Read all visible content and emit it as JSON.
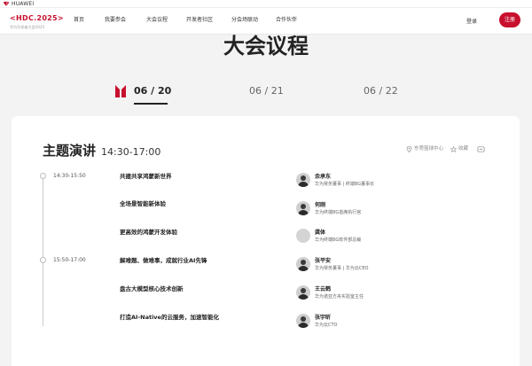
{
  "topbar": {
    "brand_text": "HUAWEI"
  },
  "header": {
    "logo_code": "<HDC.2025>",
    "logo_sub": "华为开发者大会2025",
    "nav": [
      "首页",
      "我要参会",
      "大会议程",
      "开发者社区",
      "分会场联动",
      "合作伙伴"
    ],
    "login": "登录",
    "register": "注册"
  },
  "page": {
    "title": "大会议程"
  },
  "tabs": [
    {
      "label": "06 / 20",
      "active": true
    },
    {
      "label": "06 / 21",
      "active": false
    },
    {
      "label": "06 / 22",
      "active": false
    }
  ],
  "section": {
    "title": "主题演讲",
    "time": "14:30-17:00",
    "location": "东莞篮球中心",
    "favorite": "收藏",
    "share_icon": "share-icon"
  },
  "slots": [
    {
      "time": "14:30-15:50"
    },
    {
      "time": "15:50-17:00"
    }
  ],
  "sessions": [
    {
      "title": "共建共享鸿蒙新世界",
      "speaker": "余承东",
      "role": "华为常务董事 | 终端BG董事长",
      "avatar": "photo"
    },
    {
      "title": "全场景智能新体验",
      "speaker": "何刚",
      "role": "华为终端BG首席执行官",
      "avatar": "photo"
    },
    {
      "title": "更高效的鸿蒙开发体验",
      "speaker": "龚体",
      "role": "华为终端BG软件部总裁",
      "avatar": "blank"
    },
    {
      "title": "解难题、做难事，成就行业AI先锋",
      "speaker": "张平安",
      "role": "华为常务董事 | 华为云CEO",
      "avatar": "photo"
    },
    {
      "title": "盘古大模型核心技术创新",
      "speaker": "王云鹤",
      "role": "华为诺亚方舟实验室主任",
      "avatar": "photo"
    },
    {
      "title": "打造AI-Native的云服务，加速智能化",
      "speaker": "张宇昕",
      "role": "华为云CTO",
      "avatar": "photo"
    }
  ],
  "colors": {
    "accent": "#c8102e",
    "text": "#222222",
    "background": "#f3f3f3"
  }
}
